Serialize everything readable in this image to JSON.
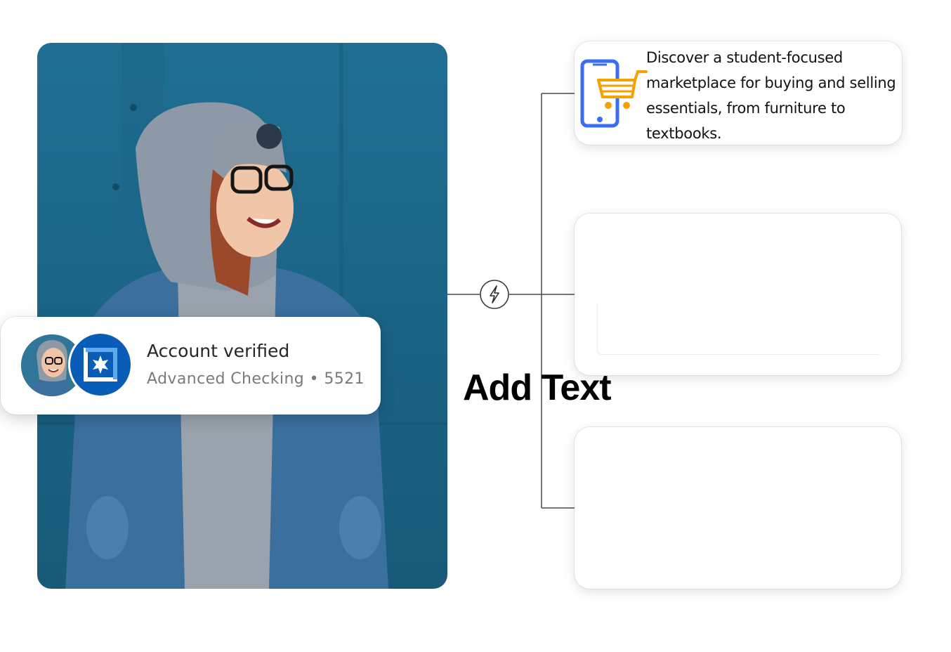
{
  "verified_card": {
    "title": "Account verified",
    "subtitle": "Advanced Checking • 5521"
  },
  "cards": [
    {
      "text": "Discover a student-focused marketplace for buying and selling essentials, from furniture to textbooks.",
      "icon": "phone-shopping-cart-icon"
    },
    {
      "text": ""
    },
    {
      "text": ""
    }
  ],
  "center_label": "Add Text",
  "hub_icon": "lightning-bolt-icon",
  "colors": {
    "photo_background": "#1f6f93",
    "bank_badge": "#0a5db6",
    "phone_icon": "#3b6ef5",
    "cart_icon": "#f5a100"
  }
}
